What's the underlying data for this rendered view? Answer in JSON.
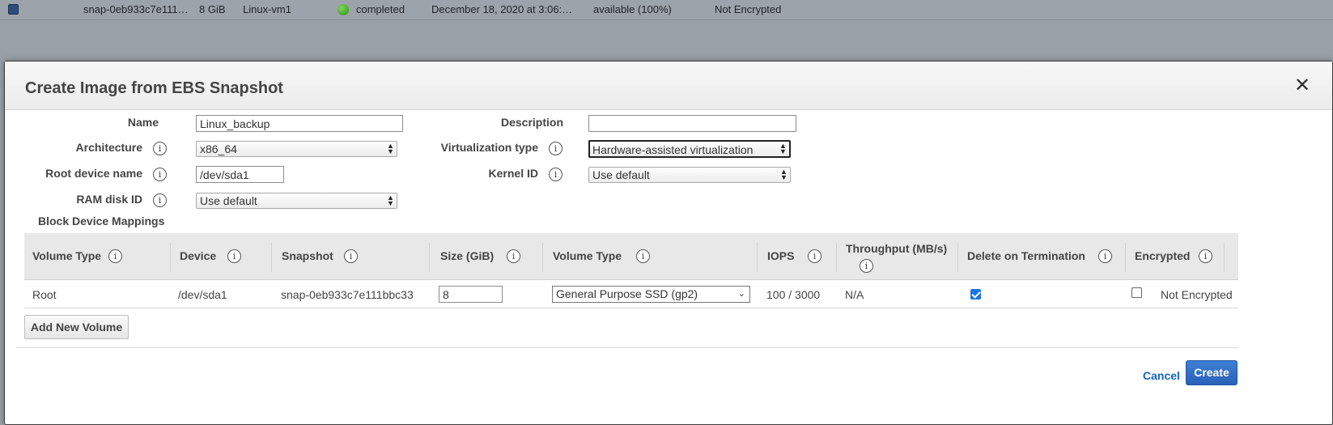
{
  "background_row": {
    "snapshot_id": "snap-0eb933c7e111…",
    "size": "8 GiB",
    "description": "Linux-vm1",
    "status": "completed",
    "started": "December 18, 2020 at 3:06:…",
    "progress": "available (100%)",
    "encryption": "Not Encrypted",
    "status_color": "#3aa52b"
  },
  "modal": {
    "title": "Create Image from EBS Snapshot",
    "close_icon": "close-icon"
  },
  "form": {
    "name_label": "Name",
    "name_value": "Linux_backup",
    "description_label": "Description",
    "description_value": "",
    "architecture_label": "Architecture",
    "architecture_value": "x86_64",
    "virtualization_label": "Virtualization type",
    "virtualization_value": "Hardware-assisted virtualization",
    "root_device_label": "Root device name",
    "root_device_value": "/dev/sda1",
    "kernel_label": "Kernel ID",
    "kernel_value": "Use default",
    "ramdisk_label": "RAM disk ID",
    "ramdisk_value": "Use default",
    "info_glyph": "i"
  },
  "block_device_mappings": {
    "label": "Block Device Mappings",
    "columns": [
      "Volume Type",
      "Device",
      "Snapshot",
      "Size (GiB)",
      "Volume Type",
      "IOPS",
      "Throughput (MB/s)",
      "Delete on Termination",
      "Encrypted"
    ],
    "rows": [
      {
        "volume_type": "Root",
        "device": "/dev/sda1",
        "snapshot": "snap-0eb933c7e111bbc33",
        "size": "8",
        "ebs_volume_type": "General Purpose SSD (gp2)",
        "iops": "100 / 3000",
        "throughput": "N/A",
        "delete_on_termination": true,
        "encrypted": false,
        "encryption_text": "Not Encrypted"
      }
    ],
    "add_button": "Add New Volume"
  },
  "footer": {
    "cancel_label": "Cancel",
    "create_label": "Create",
    "accent_color": "#2a62b8"
  }
}
